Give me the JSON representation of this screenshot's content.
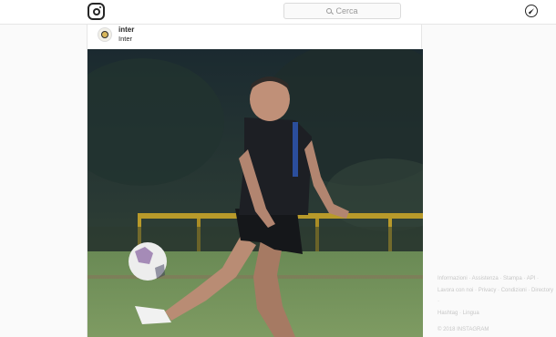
{
  "nav": {
    "search_placeholder": "Cerca"
  },
  "post": {
    "username": "inter",
    "location": "Inter"
  },
  "footer": {
    "line1": "Informazioni · Assistenza · Stampa · API ·",
    "line2": "Lavora con noi · Privacy · Condizioni · Directory ·",
    "line3": "Hashtag · Lingua",
    "copyright": "© 2018 INSTAGRAM"
  },
  "icons": {
    "logo": "instagram-glyph-icon",
    "search": "search-icon",
    "explore": "compass-icon",
    "avatar": "inter-crest-icon"
  }
}
